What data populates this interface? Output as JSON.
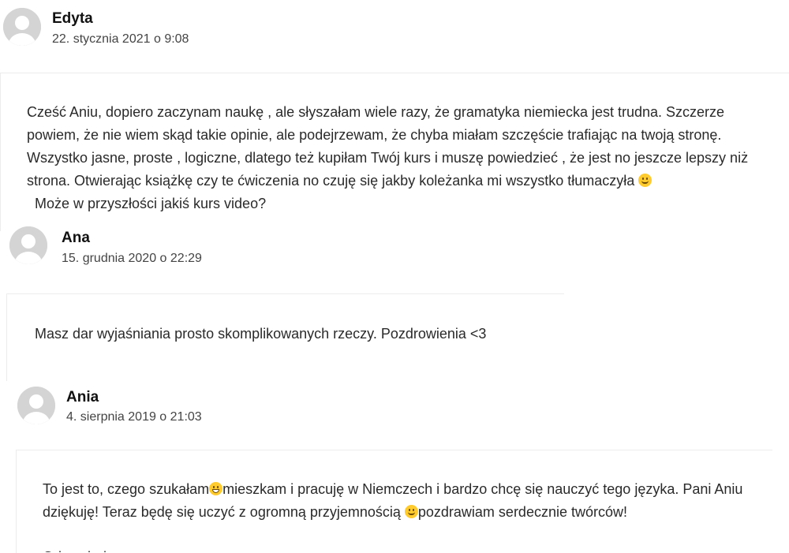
{
  "comments": [
    {
      "author": "Edyta",
      "date": "22. stycznia 2021 o 9:08",
      "text_parts": [
        "Cześć Aniu, dopiero zaczynam naukę , ale słyszałam wiele razy, że gramatyka niemiecka jest trudna. Szczerze powiem, że nie wiem skąd takie opinie, ale podejrzewam, że chyba miałam szczęście trafiając na twoją stronę. Wszystko jasne, proste , logiczne, dlatego też kupiłam Twój kurs i muszę powiedzieć , że jest no jeszcze lepszy niż strona. Otwierając książkę czy te ćwiczenia no czuję się jakby koleżanka mi wszystko tłumaczyła ",
        "  Może w przyszłości jakiś kurs video?"
      ],
      "emoji": [
        "slightly-smiling-face-icon"
      ]
    },
    {
      "author": "Ana",
      "date": "15. grudnia 2020 o 22:29",
      "text_parts": [
        "Masz dar wyjaśniania prosto skomplikowanych rzeczy. Pozdrowienia <3"
      ]
    },
    {
      "author": "Ania",
      "date": "4. sierpnia 2019 o 21:03",
      "text_parts": [
        "To jest to, czego szukałam",
        "mieszkam i pracuję w Niemczech i bardzo chcę się nauczyć tego języka. Pani Aniu dziękuję! Teraz będę się uczyć z ogromną przyjemnością ",
        "pozdrawiam serdecznie twórców!"
      ],
      "emoji": [
        "grinning-face-icon",
        "slightly-smiling-face-icon"
      ],
      "next_line_partial": "Odpowiedz"
    }
  ],
  "colors": {
    "avatar_bg": "#d4d4d4",
    "avatar_fg": "#ffffff",
    "text": "#2a2a2a",
    "border": "#ececec",
    "emoji": "#ffcb2e"
  }
}
